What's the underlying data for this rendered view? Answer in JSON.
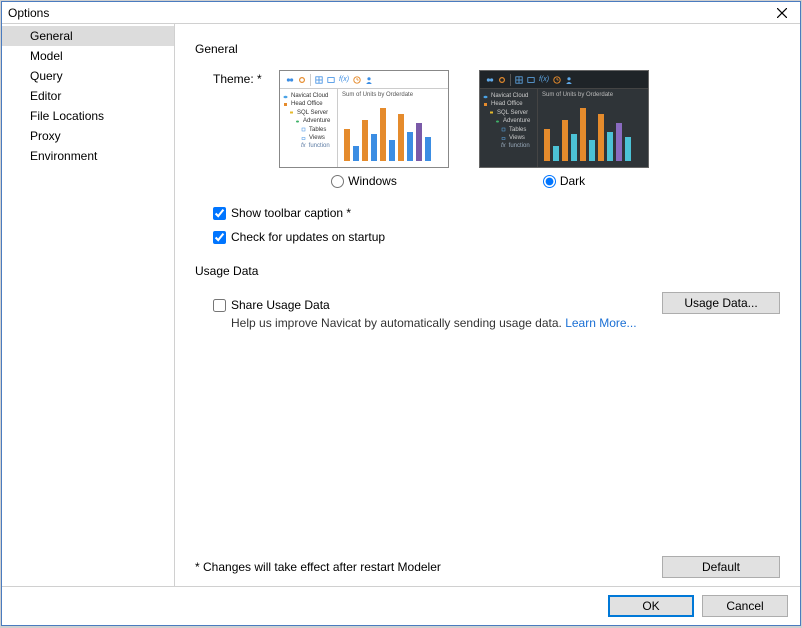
{
  "window": {
    "title": "Options"
  },
  "sidebar": {
    "items": [
      {
        "label": "General",
        "selected": true
      },
      {
        "label": "Model",
        "selected": false
      },
      {
        "label": "Query",
        "selected": false
      },
      {
        "label": "Editor",
        "selected": false
      },
      {
        "label": "File Locations",
        "selected": false
      },
      {
        "label": "Proxy",
        "selected": false
      },
      {
        "label": "Environment",
        "selected": false
      }
    ]
  },
  "general": {
    "heading": "General",
    "theme_label": "Theme: *",
    "theme_windows": "Windows",
    "theme_dark": "Dark",
    "show_toolbar": "Show toolbar caption *",
    "check_updates": "Check for updates on startup"
  },
  "usage": {
    "heading": "Usage Data",
    "share_label": "Share Usage Data",
    "help_text": "Help us improve Navicat by automatically sending usage data. ",
    "learn_more": "Learn More...",
    "button": "Usage Data..."
  },
  "thumb": {
    "chart_title": "Sum of Units by Orderdate",
    "tree": {
      "cloud": "Navicat Cloud",
      "head": "Head Office",
      "sql": "SQL Server",
      "adv": "Adventure",
      "tables": "Tables",
      "views": "Views",
      "fx": "function"
    }
  },
  "note": "* Changes will take effect after restart Modeler",
  "buttons": {
    "default": "Default",
    "ok": "OK",
    "cancel": "Cancel"
  }
}
